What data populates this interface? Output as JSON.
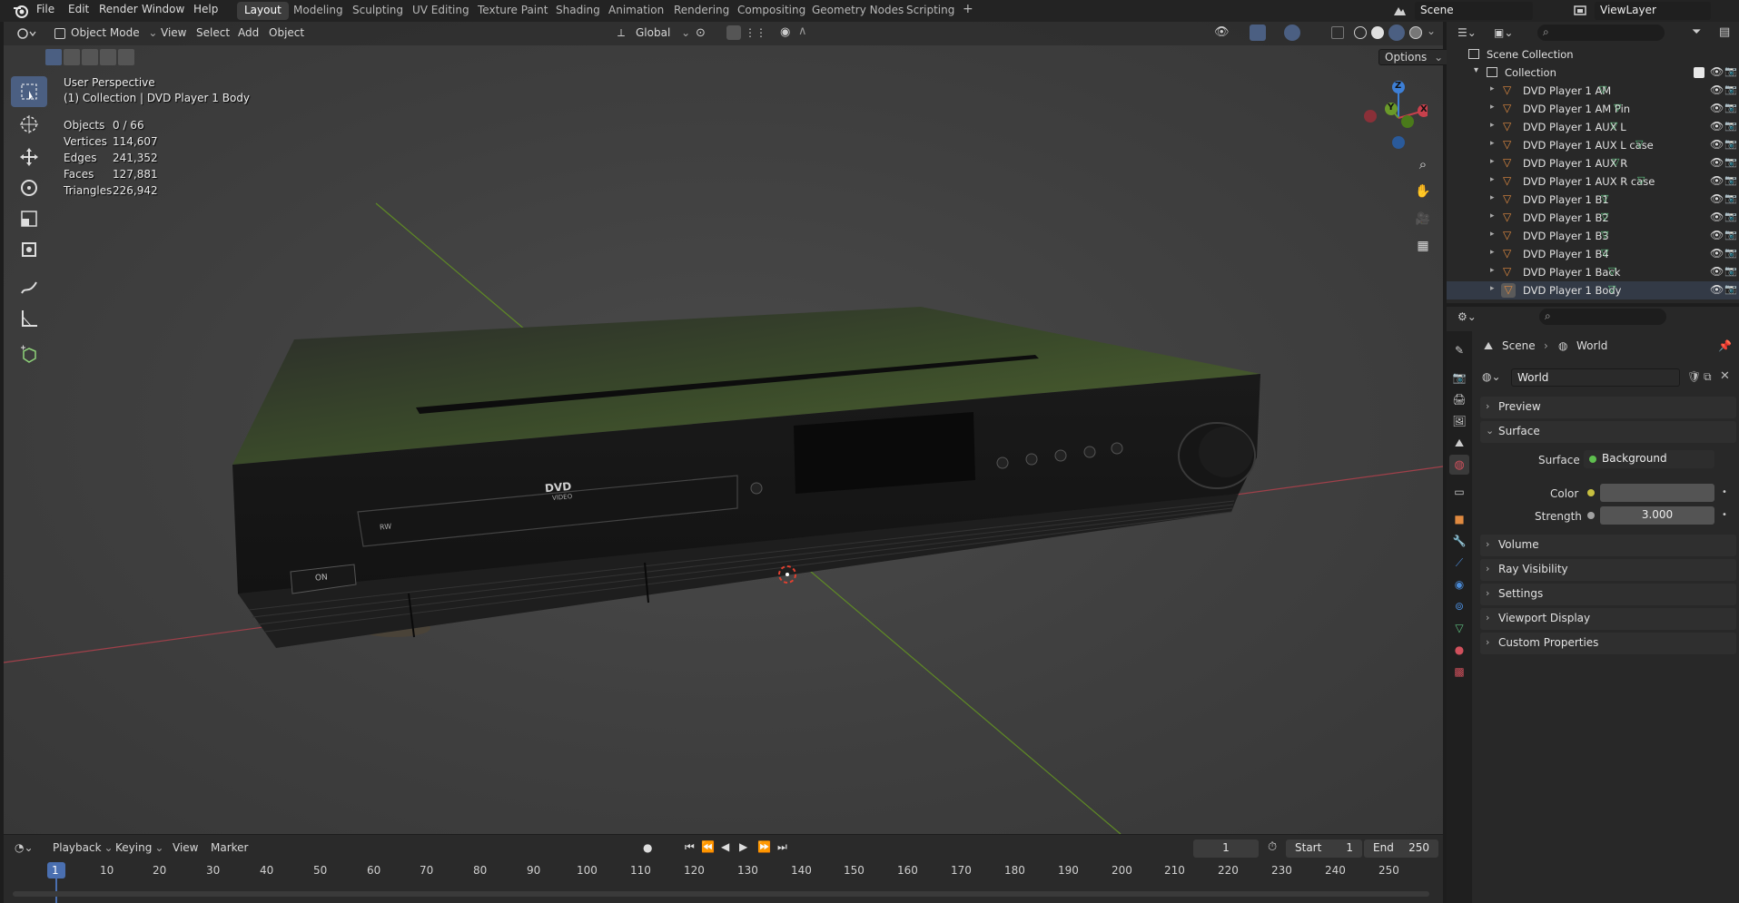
{
  "app": {
    "menus": [
      "File",
      "Edit",
      "Render",
      "Window",
      "Help"
    ],
    "workspaces": [
      "Layout",
      "Modeling",
      "Sculpting",
      "UV Editing",
      "Texture Paint",
      "Shading",
      "Animation",
      "Rendering",
      "Compositing",
      "Geometry Nodes",
      "Scripting"
    ],
    "active_workspace": "Layout",
    "add_tab": "+",
    "scene_name": "Scene",
    "view_layer": "ViewLayer"
  },
  "viewport_header": {
    "mode": "Object Mode",
    "menus": [
      "View",
      "Select",
      "Add",
      "Object"
    ],
    "transform_orientation": "Global",
    "options": "Options"
  },
  "viewport": {
    "perspective": "User Perspective",
    "context": "(1) Collection | DVD Player 1 Body",
    "stats": [
      {
        "label": "Objects",
        "value": "0 / 66"
      },
      {
        "label": "Vertices",
        "value": "114,607"
      },
      {
        "label": "Edges",
        "value": "241,352"
      },
      {
        "label": "Faces",
        "value": "127,881"
      },
      {
        "label": "Triangles",
        "value": "226,942"
      }
    ],
    "gizmo_axes": [
      "Z",
      "Y",
      "X"
    ],
    "model_labels": {
      "dvd": "DVD",
      "dvd_sub": "VIDEO",
      "power": "ON",
      "brand": "RW"
    },
    "colors": {
      "x_axis": "#b8444c",
      "y_axis": "#6a9a2a",
      "z_axis": "#3d7fd6"
    }
  },
  "tools": [
    "select-box",
    "cursor",
    "move",
    "rotate",
    "scale",
    "transform",
    "annotate",
    "measure",
    "add-cube"
  ],
  "outliner": {
    "root": "Scene Collection",
    "collection": "Collection",
    "items": [
      "DVD Player 1 AM",
      "DVD Player 1 AM Pin",
      "DVD Player 1 AUX L",
      "DVD Player 1 AUX L case",
      "DVD Player 1 AUX R",
      "DVD Player 1 AUX R case",
      "DVD Player 1 B1",
      "DVD Player 1 B2",
      "DVD Player 1 B3",
      "DVD Player 1 B4",
      "DVD Player 1 Back",
      "DVD Player 1 Body"
    ],
    "selected": "DVD Player 1 Body"
  },
  "properties": {
    "breadcrumb": [
      "Scene",
      "World"
    ],
    "world_name": "World",
    "panels": {
      "preview": "Preview",
      "surface": "Surface",
      "volume": "Volume",
      "ray_visibility": "Ray Visibility",
      "settings": "Settings",
      "viewport_display": "Viewport Display",
      "custom_properties": "Custom Properties"
    },
    "surface_label": "Surface",
    "surface_value": "Background",
    "color_label": "Color",
    "strength_label": "Strength",
    "strength_value": "3.000",
    "world_color": "#5a5a5a"
  },
  "timeline": {
    "menus": [
      "Playback",
      "Keying",
      "View",
      "Marker"
    ],
    "current_frame": "1",
    "start_label": "Start",
    "start_value": "1",
    "end_label": "End",
    "end_value": "250",
    "ticks": [
      "1",
      "10",
      "20",
      "30",
      "40",
      "50",
      "60",
      "70",
      "80",
      "90",
      "100",
      "110",
      "120",
      "130",
      "140",
      "150",
      "160",
      "170",
      "180",
      "190",
      "200",
      "210",
      "220",
      "230",
      "240",
      "250"
    ]
  }
}
